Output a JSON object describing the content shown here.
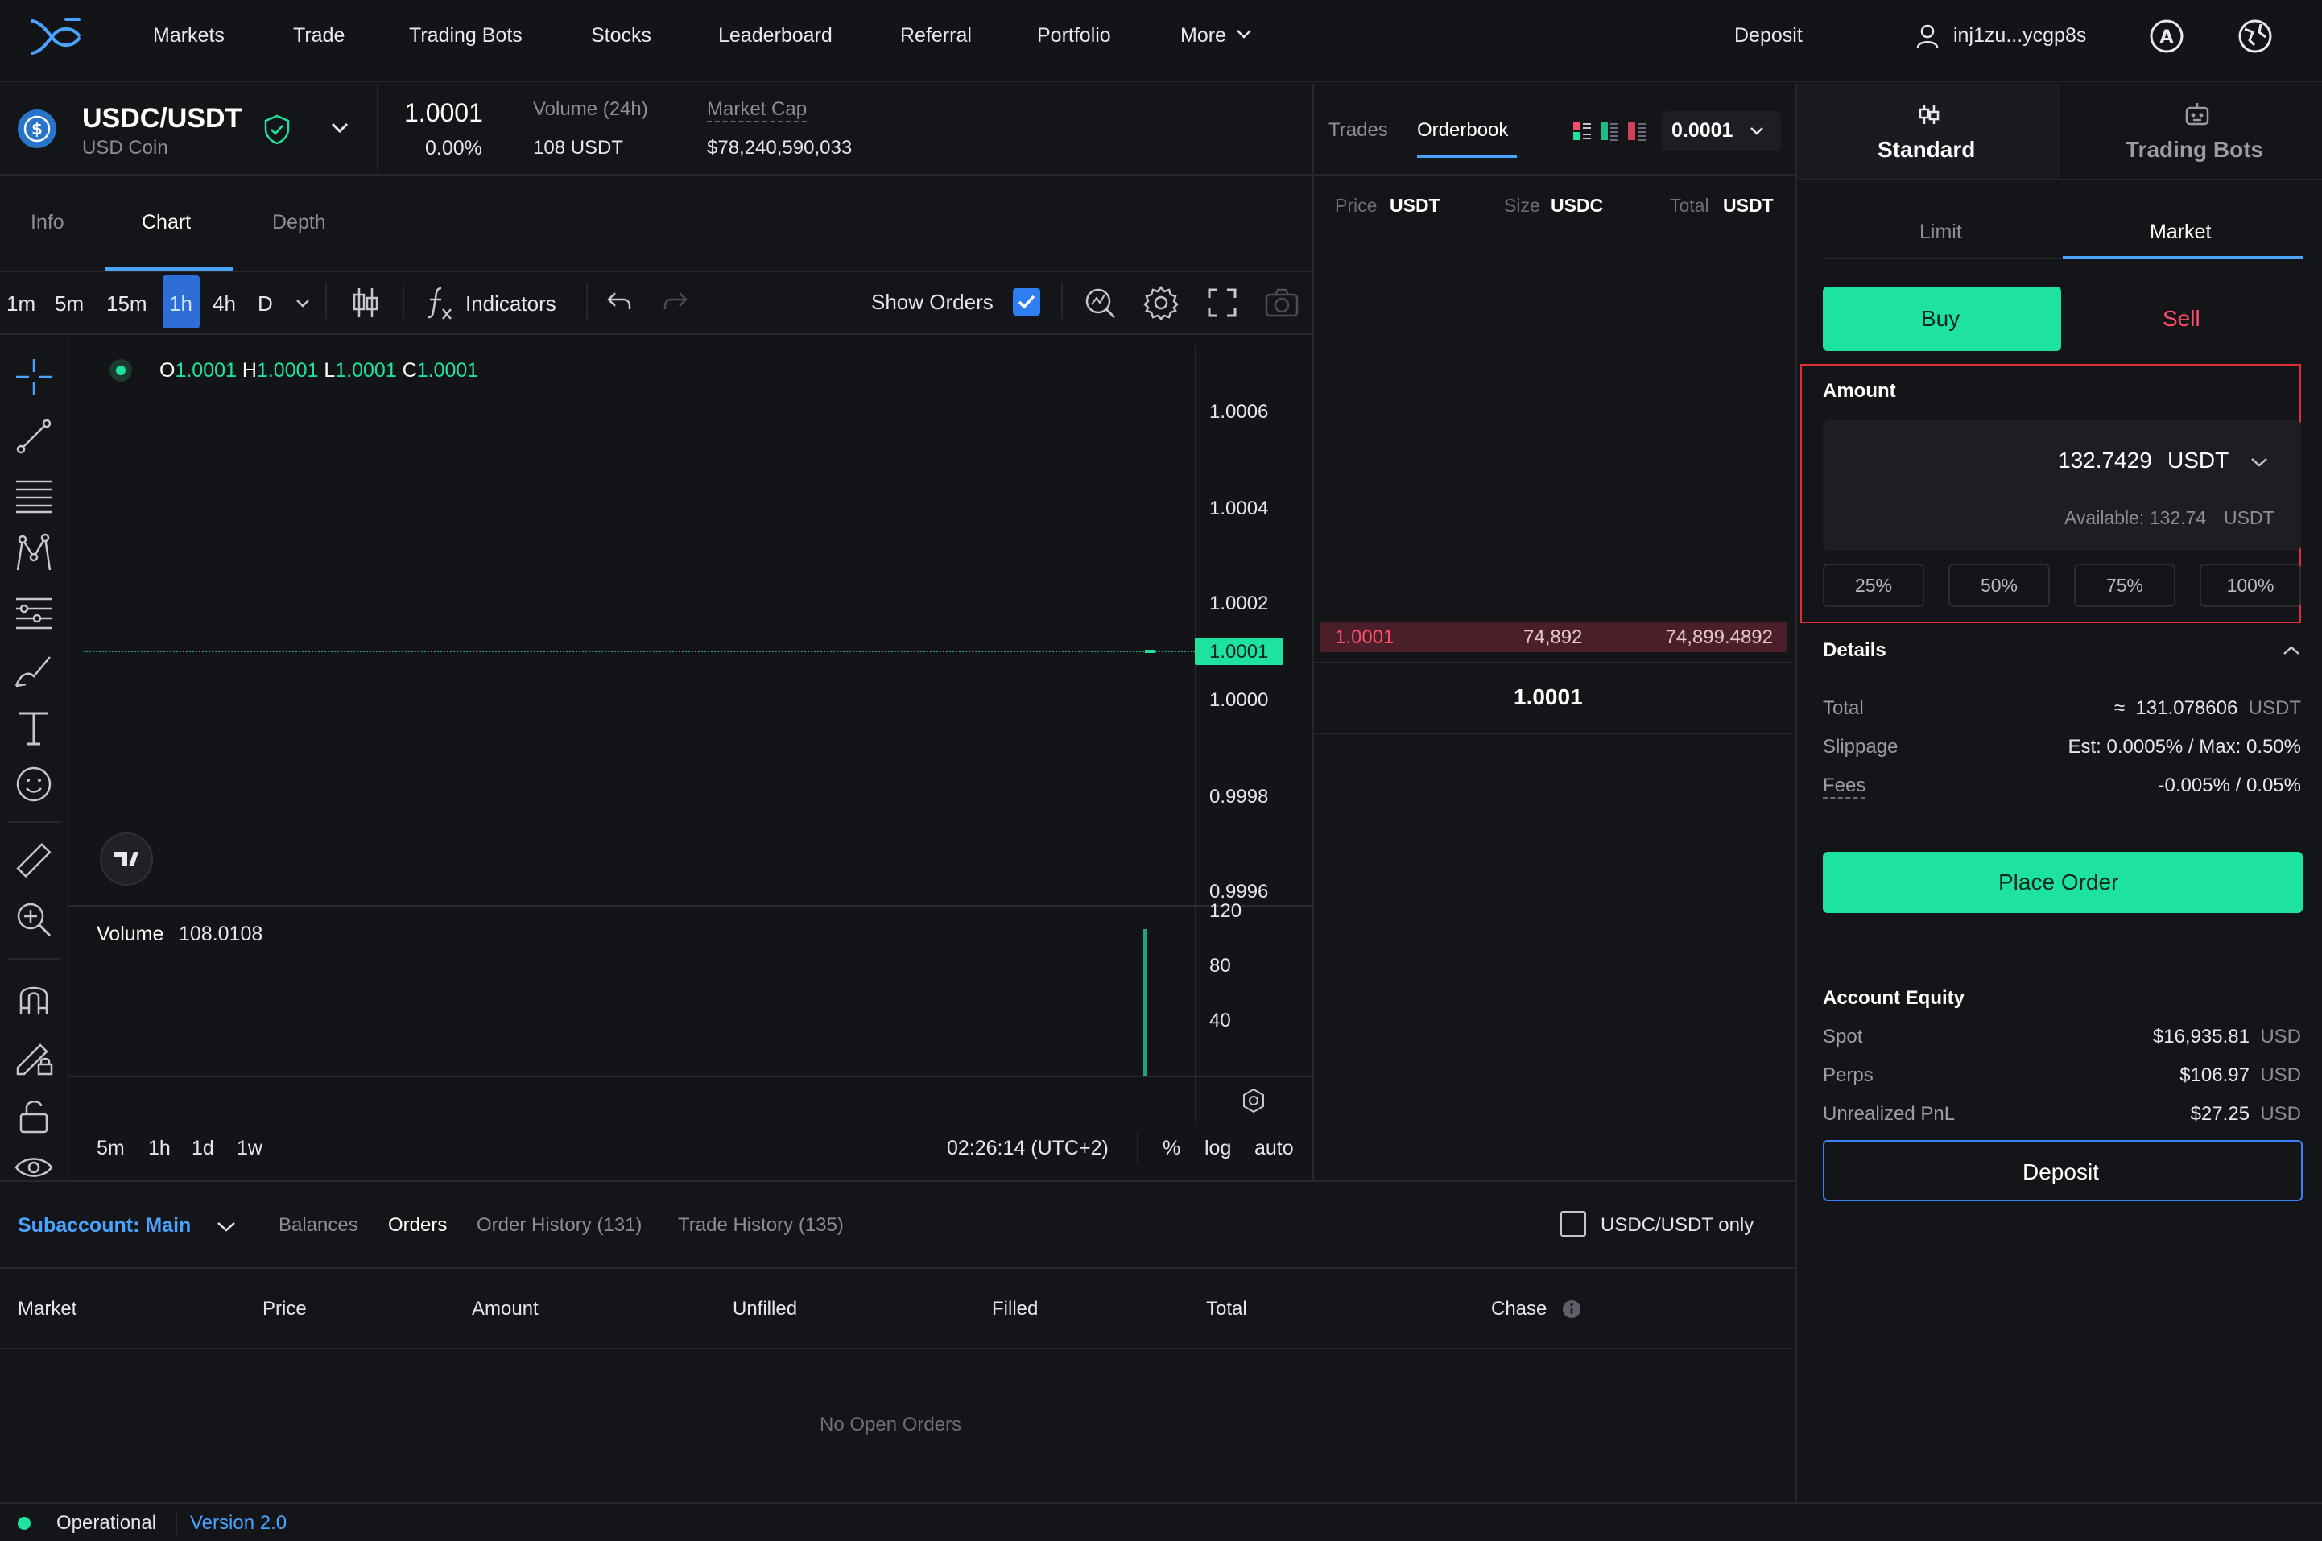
{
  "nav": {
    "items": [
      "Markets",
      "Trade",
      "Trading Bots",
      "Stocks",
      "Leaderboard",
      "Referral",
      "Portfolio",
      "More"
    ],
    "deposit": "Deposit",
    "account": "inj1zu...ycgp8s"
  },
  "market": {
    "pair": "USDC/USDT",
    "name": "USD Coin",
    "price": "1.0001",
    "change": "0.00%",
    "volume_label": "Volume (24h)",
    "volume_value": "108 USDT",
    "mcap_label": "Market Cap",
    "mcap_value": "$78,240,590,033"
  },
  "chart_tabs": [
    "Info",
    "Chart",
    "Depth"
  ],
  "timeframes": [
    "1m",
    "5m",
    "15m",
    "1h",
    "4h",
    "D"
  ],
  "toolbar": {
    "indicators": "Indicators",
    "show_orders": "Show Orders"
  },
  "ohlc": {
    "o_label": "O",
    "o": "1.0001",
    "h_label": "H",
    "h": "1.0001",
    "l_label": "L",
    "l": "1.0001",
    "c_label": "C",
    "c": "1.0001"
  },
  "price_axis": [
    "1.0006",
    "1.0004",
    "1.0002",
    "1.0001",
    "1.0000",
    "0.9998",
    "0.9996"
  ],
  "volume": {
    "label": "Volume",
    "value": "108.0108",
    "axis": [
      "120",
      "80",
      "40"
    ]
  },
  "chart_footer": {
    "ranges": [
      "5m",
      "1h",
      "1d",
      "1w"
    ],
    "time": "02:26:14 (UTC+2)",
    "pct": "%",
    "log": "log",
    "auto": "auto"
  },
  "orderbook": {
    "tabs": [
      "Trades",
      "Orderbook"
    ],
    "precision": "0.0001",
    "headers": {
      "price": "Price",
      "price_unit": "USDT",
      "size": "Size",
      "size_unit": "USDC",
      "total": "Total",
      "total_unit": "USDT"
    },
    "asks": [
      {
        "price": "1.0001",
        "size": "74,892",
        "total": "74,899.4892"
      }
    ],
    "mid_price": "1.0001"
  },
  "trade_panel": {
    "modes": [
      "Standard",
      "Trading Bots"
    ],
    "order_types": [
      "Limit",
      "Market"
    ],
    "buy": "Buy",
    "sell": "Sell",
    "amount_label": "Amount",
    "amount_value": "132.7429",
    "amount_unit": "USDT",
    "available": "Available: 132.74",
    "available_unit": "USDT",
    "percent_buttons": [
      "25%",
      "50%",
      "75%",
      "100%"
    ],
    "details_label": "Details",
    "total_label": "Total",
    "total_value": "131.078606",
    "total_unit": "USDT",
    "approx": "≈",
    "slippage_label": "Slippage",
    "slippage_value": "Est: 0.0005% / Max: 0.50%",
    "fees_label": "Fees",
    "fees_value": "-0.005% / 0.05%",
    "place_order": "Place Order",
    "equity_label": "Account Equity",
    "spot_label": "Spot",
    "spot_value": "$16,935.81",
    "perps_label": "Perps",
    "perps_value": "$106.97",
    "pnl_label": "Unrealized PnL",
    "pnl_value": "$27.25",
    "currency": "USD",
    "deposit": "Deposit"
  },
  "bottom": {
    "subaccount": "Subaccount: Main",
    "tabs": [
      "Balances",
      "Orders",
      "Order History (131)",
      "Trade History (135)"
    ],
    "filter": "USDC/USDT only",
    "columns": [
      "Market",
      "Price",
      "Amount",
      "Unfilled",
      "Filled",
      "Total",
      "Chase"
    ],
    "empty": "No Open Orders"
  },
  "status": {
    "state": "Operational",
    "version": "Version 2.0"
  },
  "colors": {
    "accent_green": "#1ee3a0",
    "sell_red": "#ff4d6a",
    "link_blue": "#4aa3ff",
    "highlight_box": "#e0303a"
  }
}
